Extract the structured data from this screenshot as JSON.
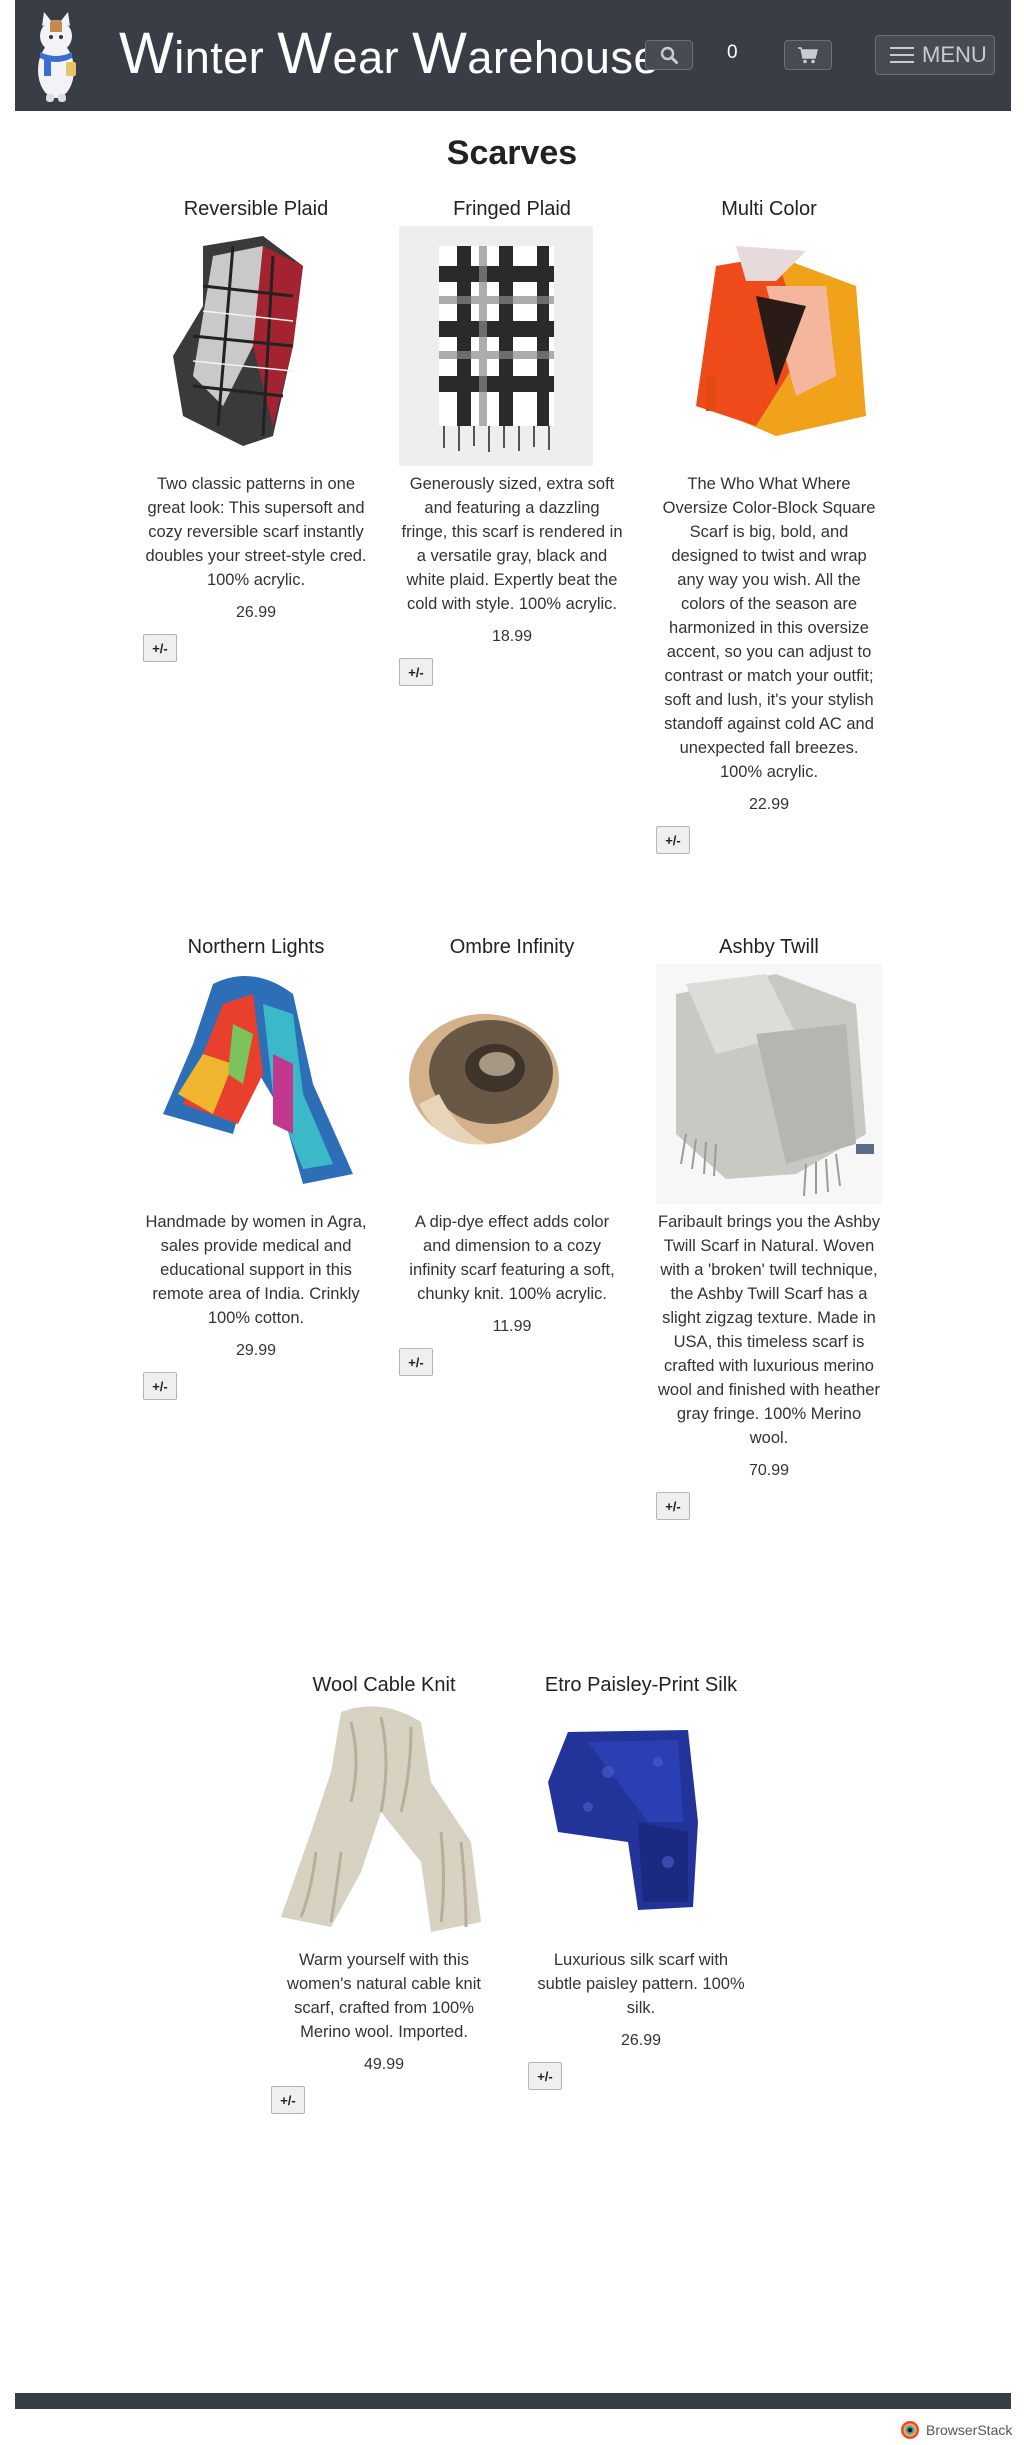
{
  "header": {
    "brand": {
      "w1": "W",
      "r1": "inter ",
      "w2": "W",
      "r2": "ear ",
      "w3": "W",
      "r3": "arehouse"
    },
    "cart_count": "0",
    "menu_label": "MENU"
  },
  "page_title": "Scarves",
  "products": [
    {
      "title": "Reversible Plaid",
      "description": "Two classic patterns in one great look: This supersoft and cozy reversible scarf instantly doubles your street-style cred. 100% acrylic.",
      "price": "26.99",
      "qty_label": "+/-"
    },
    {
      "title": "Fringed Plaid",
      "description": "Generously sized, extra soft and featuring a dazzling fringe, this scarf is rendered in a versatile gray, black and white plaid. Expertly beat the cold with style. 100% acrylic.",
      "price": "18.99",
      "qty_label": "+/-"
    },
    {
      "title": "Multi Color",
      "description": "The Who What Where Oversize Color-Block Square Scarf is big, bold, and designed to twist and wrap any way you wish. All the colors of the season are harmonized in this oversize accent, so you can adjust to contrast or match your outfit; soft and lush, it's your stylish standoff against cold AC and unexpected fall breezes. 100% acrylic.",
      "price": "22.99",
      "qty_label": "+/-"
    },
    {
      "title": "Northern Lights",
      "description": "Handmade by women in Agra, sales provide medical and educational support in this remote area of India. Crinkly 100% cotton.",
      "price": "29.99",
      "qty_label": "+/-"
    },
    {
      "title": "Ombre Infinity",
      "description": "A dip-dye effect adds color and dimension to a cozy infinity scarf featuring a soft, chunky knit. 100% acrylic.",
      "price": "11.99",
      "qty_label": "+/-"
    },
    {
      "title": "Ashby Twill",
      "description": "Faribault brings you the Ashby Twill Scarf in Natural. Woven with a 'broken' twill technique, the Ashby Twill Scarf has a slight zigzag texture. Made in USA, this timeless scarf is crafted with luxurious merino wool and finished with heather gray fringe. 100% Merino wool.",
      "price": "70.99",
      "qty_label": "+/-"
    },
    {
      "title": "Wool Cable Knit",
      "description": "Warm yourself with this women's natural cable knit scarf, crafted from 100% Merino wool. Imported.",
      "price": "49.99",
      "qty_label": "+/-"
    },
    {
      "title": "Etro Paisley-Print Silk",
      "description": "Luxurious silk scarf with subtle paisley pattern. 100% silk.",
      "price": "26.99",
      "qty_label": "+/-"
    }
  ],
  "footer": {
    "browserstack": "BrowserStack"
  },
  "colors": {
    "header_bg": "#393e46",
    "text": "#333333"
  },
  "icons": {
    "search": "search-icon",
    "cart": "cart-icon",
    "menu": "hamburger-icon",
    "logo": "cat-mascot-logo"
  }
}
